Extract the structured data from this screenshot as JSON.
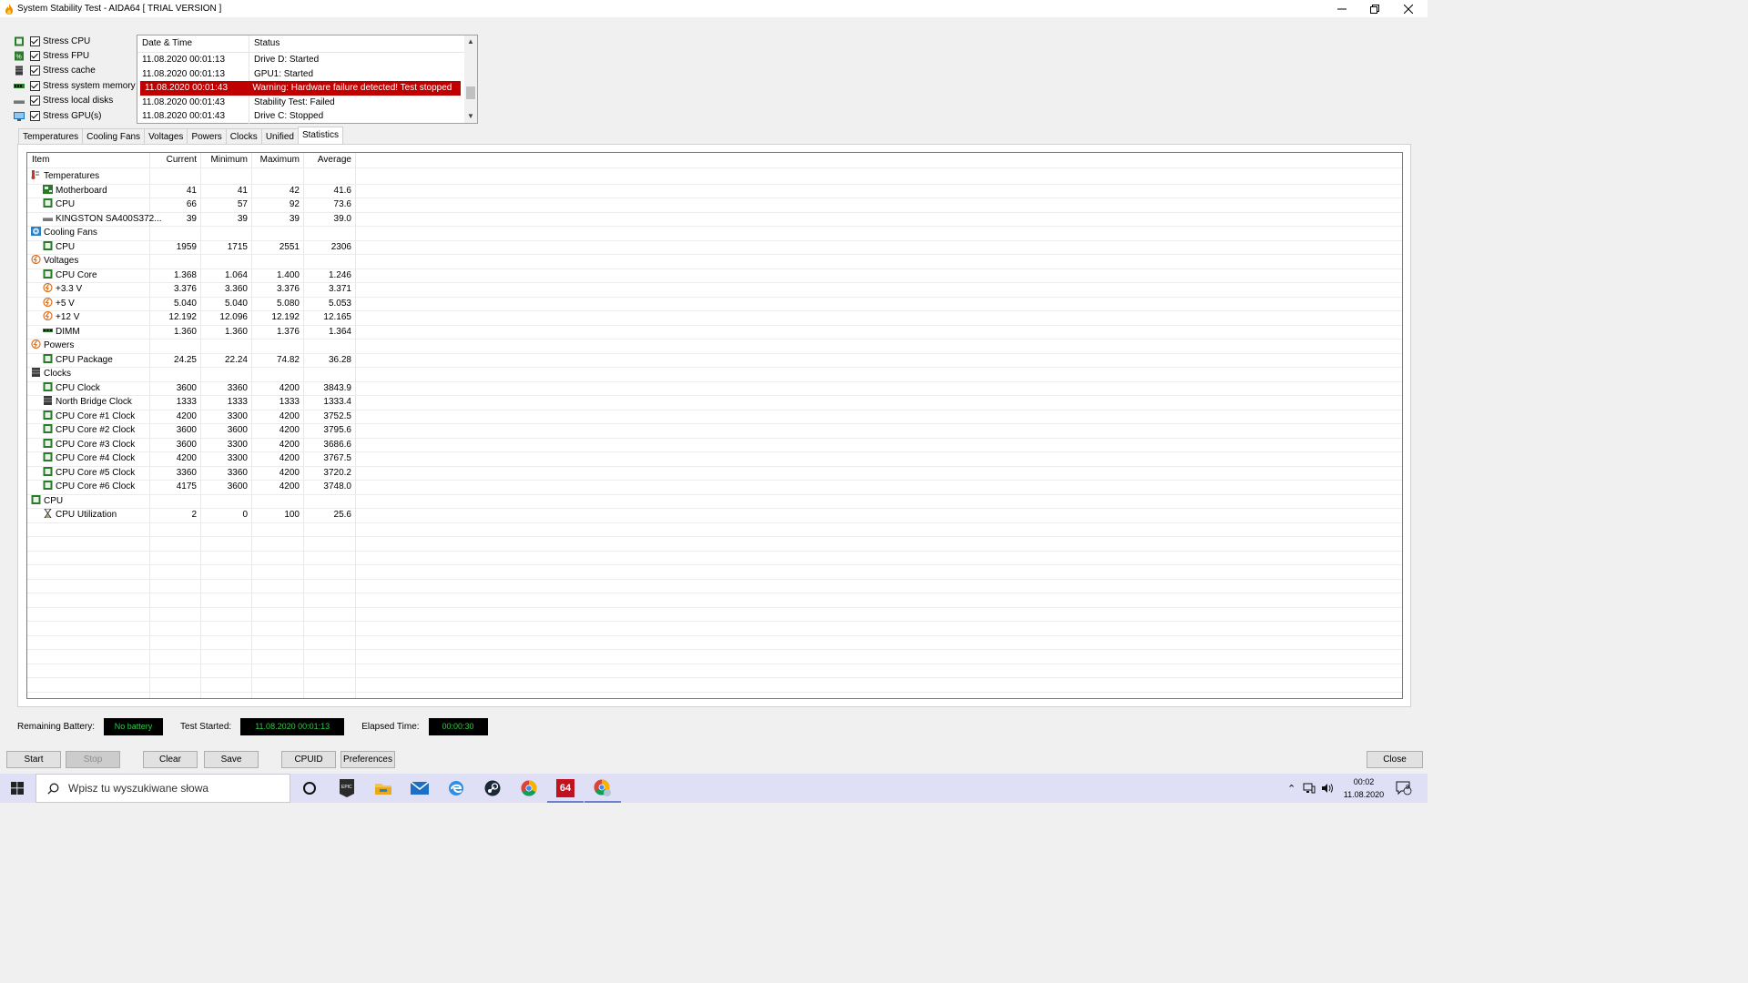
{
  "window": {
    "title": "System Stability Test - AIDA64  [ TRIAL VERSION ]",
    "controls": [
      "minimize",
      "restore",
      "close"
    ]
  },
  "stress_options": [
    {
      "label": "Stress CPU",
      "checked": true,
      "icon": "cpu-icon"
    },
    {
      "label": "Stress FPU",
      "checked": true,
      "icon": "fpu-icon"
    },
    {
      "label": "Stress cache",
      "checked": true,
      "icon": "cache-icon"
    },
    {
      "label": "Stress system memory",
      "checked": true,
      "icon": "memory-icon"
    },
    {
      "label": "Stress local disks",
      "checked": true,
      "icon": "disk-icon"
    },
    {
      "label": "Stress GPU(s)",
      "checked": true,
      "icon": "gpu-icon"
    }
  ],
  "log": {
    "headers": {
      "date": "Date & Time",
      "status": "Status"
    },
    "rows": [
      {
        "date": "11.08.2020 00:01:13",
        "status": "Drive D: Started"
      },
      {
        "date": "11.08.2020 00:01:13",
        "status": "GPU1: Started"
      },
      {
        "date": "11.08.2020 00:01:43",
        "status": "Warning: Hardware failure detected! Test stopped",
        "error": true
      },
      {
        "date": "11.08.2020 00:01:43",
        "status": "Stability Test: Failed"
      },
      {
        "date": "11.08.2020 00:01:43",
        "status": "Drive C: Stopped"
      }
    ]
  },
  "tabs": [
    "Temperatures",
    "Cooling Fans",
    "Voltages",
    "Powers",
    "Clocks",
    "Unified",
    "Statistics"
  ],
  "active_tab": "Statistics",
  "stats": {
    "headers": {
      "item": "Item",
      "current": "Current",
      "minimum": "Minimum",
      "maximum": "Maximum",
      "average": "Average"
    },
    "rows": [
      {
        "group": true,
        "item": "Temperatures",
        "icon": "thermometer-icon"
      },
      {
        "item": "Motherboard",
        "icon": "motherboard-icon",
        "current": "41",
        "minimum": "41",
        "maximum": "42",
        "average": "41.6"
      },
      {
        "item": "CPU",
        "icon": "cpu-icon",
        "current": "66",
        "minimum": "57",
        "maximum": "92",
        "average": "73.6"
      },
      {
        "item": "KINGSTON SA400S372...",
        "icon": "drive-icon",
        "current": "39",
        "minimum": "39",
        "maximum": "39",
        "average": "39.0"
      },
      {
        "group": true,
        "item": "Cooling Fans",
        "icon": "fan-icon"
      },
      {
        "item": "CPU",
        "icon": "cpu-icon",
        "current": "1959",
        "minimum": "1715",
        "maximum": "2551",
        "average": "2306"
      },
      {
        "group": true,
        "item": "Voltages",
        "icon": "voltage-icon"
      },
      {
        "item": "CPU Core",
        "icon": "cpu-icon",
        "current": "1.368",
        "minimum": "1.064",
        "maximum": "1.400",
        "average": "1.246"
      },
      {
        "item": "+3.3 V",
        "icon": "voltage-icon",
        "current": "3.376",
        "minimum": "3.360",
        "maximum": "3.376",
        "average": "3.371"
      },
      {
        "item": "+5 V",
        "icon": "voltage-icon",
        "current": "5.040",
        "minimum": "5.040",
        "maximum": "5.080",
        "average": "5.053"
      },
      {
        "item": "+12 V",
        "icon": "voltage-icon",
        "current": "12.192",
        "minimum": "12.096",
        "maximum": "12.192",
        "average": "12.165"
      },
      {
        "item": "DIMM",
        "icon": "memory-icon",
        "current": "1.360",
        "minimum": "1.360",
        "maximum": "1.376",
        "average": "1.364"
      },
      {
        "group": true,
        "item": "Powers",
        "icon": "power-icon"
      },
      {
        "item": "CPU Package",
        "icon": "cpu-icon",
        "current": "24.25",
        "minimum": "22.24",
        "maximum": "74.82",
        "average": "36.28"
      },
      {
        "group": true,
        "item": "Clocks",
        "icon": "chip-icon"
      },
      {
        "item": "CPU Clock",
        "icon": "cpu-icon",
        "current": "3600",
        "minimum": "3360",
        "maximum": "4200",
        "average": "3843.9"
      },
      {
        "item": "North Bridge Clock",
        "icon": "chip-icon",
        "current": "1333",
        "minimum": "1333",
        "maximum": "1333",
        "average": "1333.4"
      },
      {
        "item": "CPU Core #1 Clock",
        "icon": "cpu-icon",
        "current": "4200",
        "minimum": "3300",
        "maximum": "4200",
        "average": "3752.5"
      },
      {
        "item": "CPU Core #2 Clock",
        "icon": "cpu-icon",
        "current": "3600",
        "minimum": "3600",
        "maximum": "4200",
        "average": "3795.6"
      },
      {
        "item": "CPU Core #3 Clock",
        "icon": "cpu-icon",
        "current": "3600",
        "minimum": "3300",
        "maximum": "4200",
        "average": "3686.6"
      },
      {
        "item": "CPU Core #4 Clock",
        "icon": "cpu-icon",
        "current": "4200",
        "minimum": "3300",
        "maximum": "4200",
        "average": "3767.5"
      },
      {
        "item": "CPU Core #5 Clock",
        "icon": "cpu-icon",
        "current": "3360",
        "minimum": "3360",
        "maximum": "4200",
        "average": "3720.2"
      },
      {
        "item": "CPU Core #6 Clock",
        "icon": "cpu-icon",
        "current": "4175",
        "minimum": "3600",
        "maximum": "4200",
        "average": "3748.0"
      },
      {
        "group": true,
        "item": "CPU",
        "icon": "cpu-icon"
      },
      {
        "item": "CPU Utilization",
        "icon": "hourglass-icon",
        "current": "2",
        "minimum": "0",
        "maximum": "100",
        "average": "25.6"
      }
    ]
  },
  "status_bar": {
    "battery_label": "Remaining Battery:",
    "battery_value": "No battery",
    "started_label": "Test Started:",
    "started_value": "11.08.2020 00:01:13",
    "elapsed_label": "Elapsed Time:",
    "elapsed_value": "00:00:30"
  },
  "buttons": {
    "start": "Start",
    "stop": "Stop",
    "clear": "Clear",
    "save": "Save",
    "cpuid": "CPUID",
    "preferences": "Preferences",
    "close": "Close"
  },
  "taskbar": {
    "search_placeholder": "Wpisz tu wyszukiwane słowa",
    "apps": [
      "cortana-icon",
      "epic-games-icon",
      "file-explorer-icon",
      "mail-icon",
      "edge-icon",
      "steam-icon",
      "chrome-icon",
      "aida64-icon",
      "chrome-profile-icon"
    ],
    "aida_label": "64",
    "time": "00:02",
    "date": "11.08.2020",
    "notifications": "8"
  },
  "colors": {
    "error_row": "#c00000",
    "led_text": "#2ecc40",
    "led_bg": "#000000"
  }
}
